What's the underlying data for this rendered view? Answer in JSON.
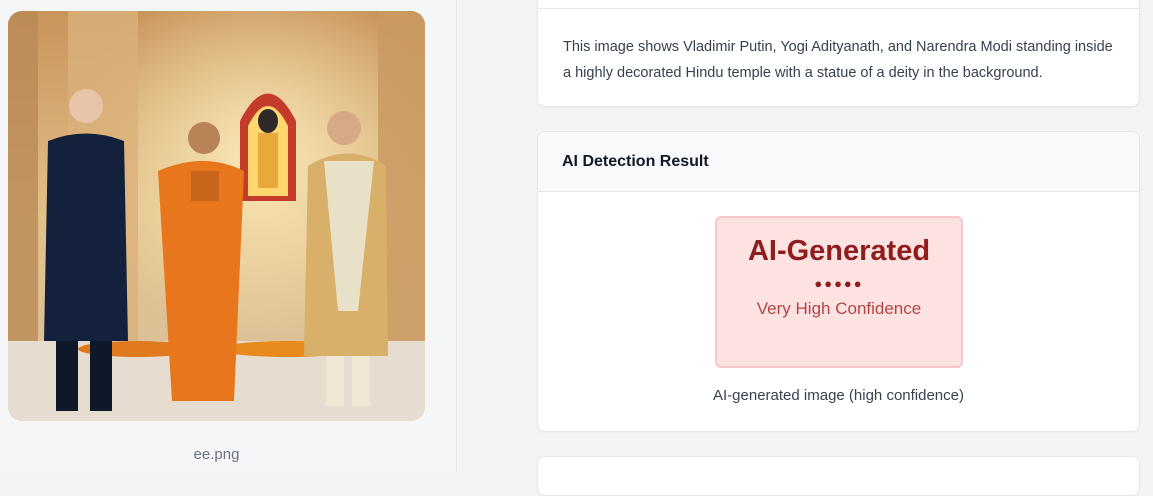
{
  "image_panel": {
    "filename": "ee.png"
  },
  "description_card": {
    "text": "This image shows Vladimir Putin, Yogi Adityanath, and Narendra Modi standing inside a highly decorated Hindu temple with a statue of a deity in the background."
  },
  "detection_card": {
    "header": "AI Detection Result",
    "verdict": "AI-Generated",
    "confidence_dots": "●●●●●",
    "confidence_level": 5,
    "confidence_label": "Very High Confidence",
    "caption": "AI-generated image (high confidence)"
  },
  "colors": {
    "verdict_text": "#8f1d1d",
    "verdict_bg": "#fde2e2",
    "verdict_border": "#f8c6c6"
  }
}
